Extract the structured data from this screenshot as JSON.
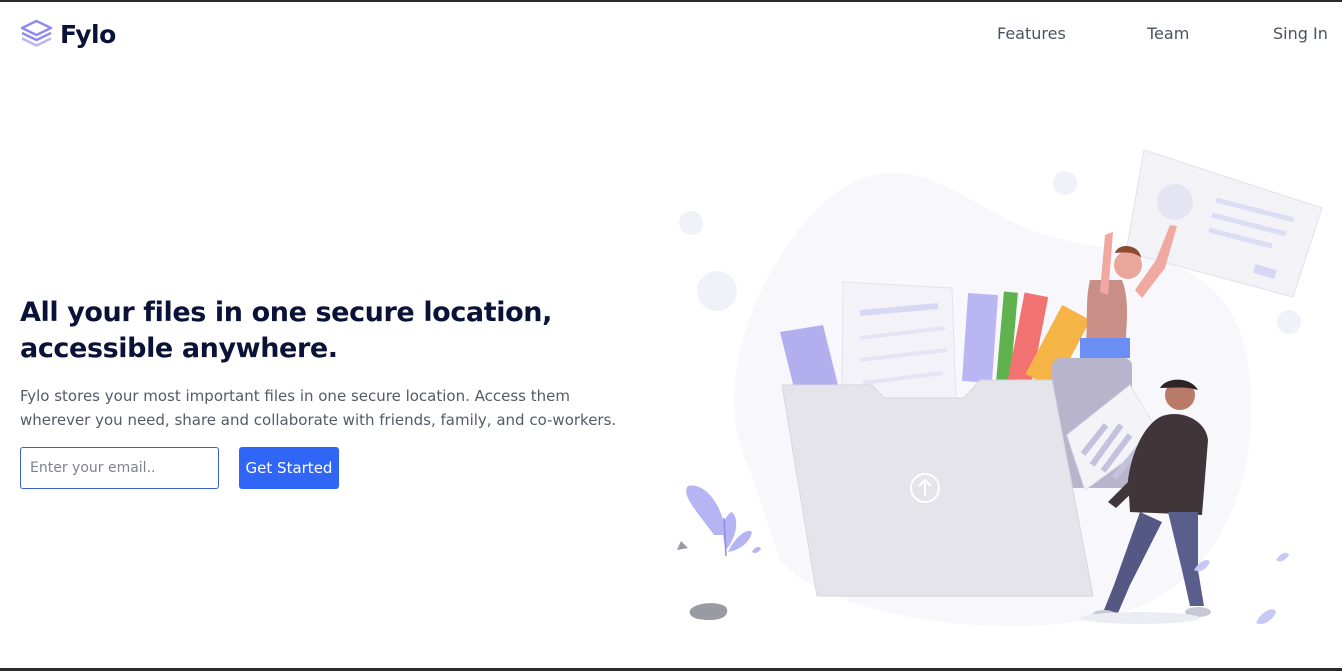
{
  "brand": {
    "name": "Fylo",
    "icon": "stacked-layers-icon",
    "accent_color": "#8f8bf1"
  },
  "nav": {
    "items": [
      {
        "label": "Features"
      },
      {
        "label": "Team"
      },
      {
        "label": "Sing In"
      }
    ]
  },
  "hero": {
    "headline_line1": "All your files in one secure location,",
    "headline_line2": "accessible anywhere.",
    "description_line1": "Fylo stores your most important files in one secure location. Access them",
    "description_line2": "wherever you need, share and collaborate with friends, family, and co-workers.",
    "email_placeholder": "Enter your email..",
    "cta_label": "Get Started",
    "cta_color": "#2f66f5"
  },
  "illustration": {
    "subject": "hero-illustration-people-with-folder",
    "folder_icon": "upload-arrow-icon"
  }
}
